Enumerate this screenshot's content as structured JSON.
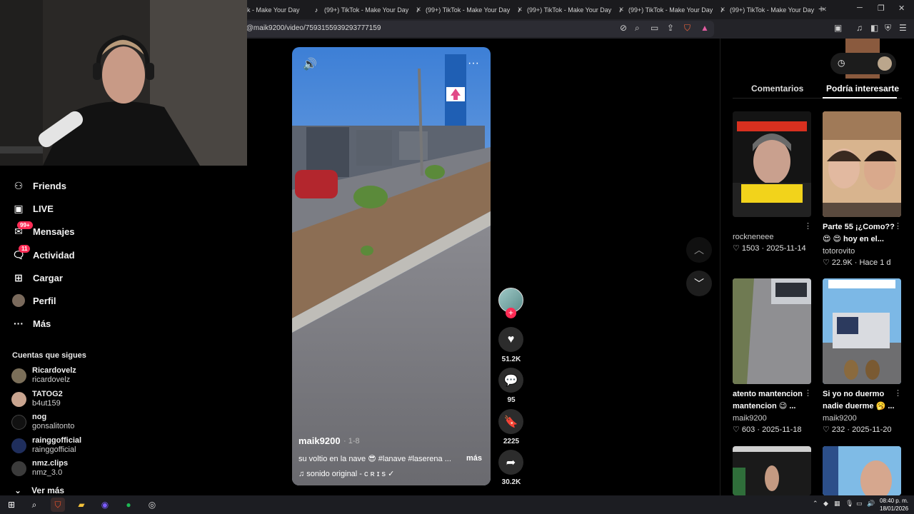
{
  "browser": {
    "tabs": [
      {
        "label": "k - Make Your Day"
      },
      {
        "label": "(99+) TikTok - Make Your Day"
      },
      {
        "label": "(99+) TikTok - Make Your Day"
      },
      {
        "label": "(99+) TikTok - Make Your Day"
      },
      {
        "label": "(99+) TikTok - Make Your Day"
      },
      {
        "label": "(99+) TikTok - Make Your Day"
      }
    ],
    "url": "/@maik9200/video/7593155939293777159"
  },
  "sidebar": {
    "items": [
      {
        "label": "Friends",
        "icon": "friends-icon"
      },
      {
        "label": "LIVE",
        "icon": "live-icon"
      },
      {
        "label": "Mensajes",
        "icon": "messages-icon",
        "badge": "99+"
      },
      {
        "label": "Actividad",
        "icon": "activity-icon",
        "badge": "11"
      },
      {
        "label": "Cargar",
        "icon": "upload-icon"
      },
      {
        "label": "Perfil",
        "icon": "profile-icon"
      },
      {
        "label": "Más",
        "icon": "more-icon"
      }
    ],
    "following_title": "Cuentas que sigues",
    "following": [
      {
        "name": "Ricardovelz",
        "handle": "ricardovelz"
      },
      {
        "name": "TATOG2",
        "handle": "b4ut159"
      },
      {
        "name": "nog",
        "handle": "gonsalitonto"
      },
      {
        "name": "rainggofficial",
        "handle": "rainggofficial"
      },
      {
        "name": "nmz.clips",
        "handle": "nmz_3.0"
      }
    ],
    "see_more": "Ver más"
  },
  "video": {
    "author": "maik9200",
    "date": "· 1-8",
    "caption": "su voltio en la nave 😎 #lanave  #laserena ...",
    "more": "más",
    "sound": "♫  sonido original - ᴄ ʀ ɪ s ✓",
    "likes": "51.2K",
    "comments": "95",
    "saves": "2225",
    "shares": "30.2K"
  },
  "panel": {
    "tab_comments": "Comentarios",
    "tab_suggested": "Podría interesarte",
    "cards": [
      {
        "title": "",
        "author": "rockneneee",
        "likes": "1503",
        "date": "2025-11-14"
      },
      {
        "title": "Parte 55 ¡¿Como?? 😍 😍 hoy en el...",
        "author": "totorovito",
        "likes": "22.9K",
        "date": "Hace 1 d"
      },
      {
        "title": "atento mantencion mantencion 😉 ...",
        "author": "maik9200",
        "likes": "603",
        "date": "2025-11-18"
      },
      {
        "title": "Si yo no duermo nadie duerme 🥱 ...",
        "author": "maik9200",
        "likes": "232",
        "date": "2025-11-20"
      }
    ]
  },
  "taskbar": {
    "time": "08:40 p. m.",
    "date": "18/01/2026"
  }
}
